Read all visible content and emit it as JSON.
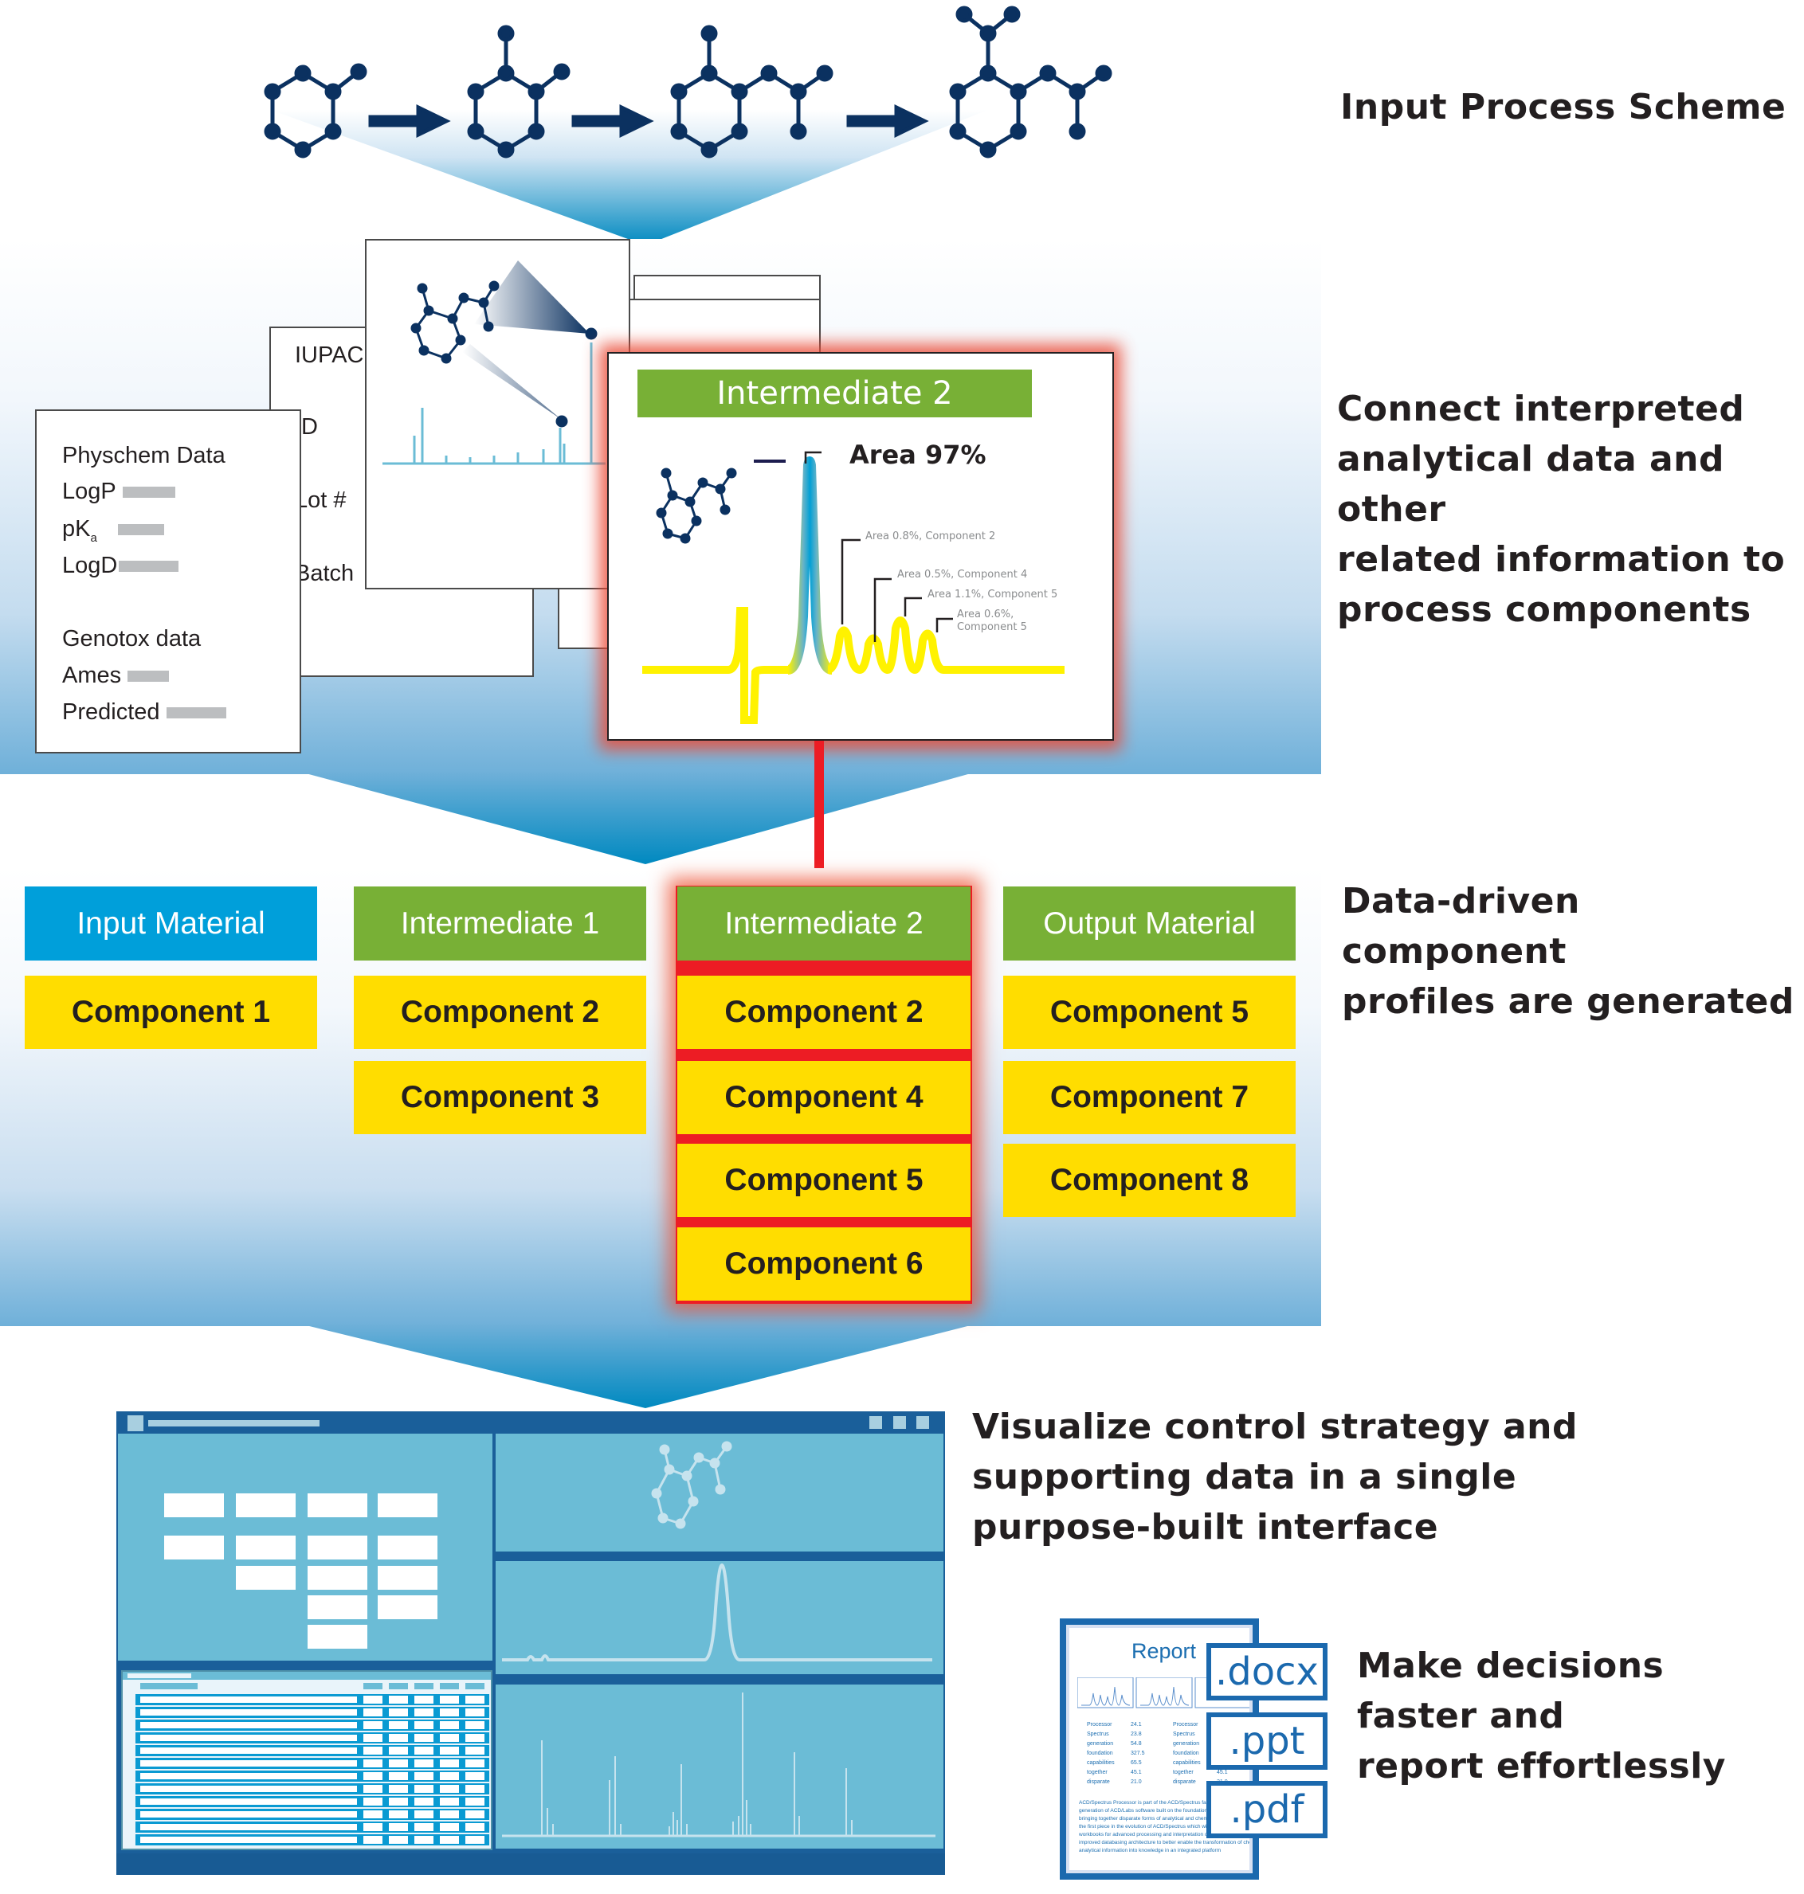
{
  "captions": {
    "step1": "Input Process Scheme",
    "step2": [
      "Connect interpreted",
      "analytical data and other",
      "related information to",
      "process components"
    ],
    "step3": [
      "Data-driven component",
      "profiles are generated"
    ],
    "step4": [
      "Visualize control strategy and",
      "supporting data in a single",
      "purpose-built interface"
    ],
    "step5": [
      "Make decisions",
      "faster and",
      "report effortlessly"
    ]
  },
  "process_scheme": {
    "molecules": [
      "starting-material",
      "intermediate-1",
      "intermediate-2",
      "output-material"
    ],
    "arrow_icon": "right-arrow-icon"
  },
  "physchem_doc": {
    "title": "Physchem Data",
    "fields": [
      {
        "label": "LogP"
      },
      {
        "label": "pK",
        "subscript": "a"
      },
      {
        "label": "LogD"
      }
    ],
    "genotox_title": "Genotox data",
    "genotox_fields": [
      {
        "label": "Ames"
      },
      {
        "label": "Predicted"
      }
    ]
  },
  "registry_doc": {
    "fields": [
      "IUPAC",
      "ID",
      "Lot #",
      "Batch"
    ]
  },
  "intermediate_doc": {
    "title": "Intermediate 2",
    "main_peak_label": "Area 97%",
    "peak_labels": [
      "Area 0.8%, Component 2",
      "Area 0.5%, Component 4",
      "Area 1.1%, Component 5",
      "Area 0.6%,",
      "Component 5"
    ]
  },
  "columns": [
    {
      "header": "Input Material",
      "type": "input",
      "components": [
        "Component 1"
      ]
    },
    {
      "header": "Intermediate 1",
      "type": "intermediate",
      "components": [
        "Component 2",
        "Component 3"
      ]
    },
    {
      "header": "Intermediate 2",
      "type": "intermediate",
      "highlighted": true,
      "components": [
        "Component 2",
        "Component 4",
        "Component 5",
        "Component 6"
      ]
    },
    {
      "header": "Output Material",
      "type": "intermediate",
      "components": [
        "Component 5",
        "Component 7",
        "Component 8"
      ]
    }
  ],
  "colors": {
    "input_header": "#009fda",
    "intermediate_header": "#78b036",
    "component": "#ffdd00",
    "highlight": "#ed1c24",
    "molecule": "#0b3160",
    "app_frame": "#1a5f9a",
    "app_panel": "#6bbcd6"
  },
  "report": {
    "title": "Report",
    "table_rows": [
      {
        "name": "Processor",
        "value": "24.1"
      },
      {
        "name": "Spectrus",
        "value": "23.8"
      },
      {
        "name": "generation",
        "value": "54.8"
      },
      {
        "name": "foundation",
        "value": "327.5"
      },
      {
        "name": "capabilities",
        "value": "65.5"
      },
      {
        "name": "together",
        "value": "45.1"
      },
      {
        "name": "disparate",
        "value": "21.0"
      }
    ],
    "paragraph": "ACD/Spectrus Processor is part of the ACD/Spectrus family of products–the next generation of ACD/Labs software built on the foundation of our unique capabilities in bringing together disparate forms of analytical and chemical information. Processor is the first piece in the evolution of ACD/Spectrus which will include analytical laboratory workbooks for advanced processing and interpretation of analytical data, and an improved databasing architecture to better enable the transformation of chemical and analytical information into knowledge in an integrated platform",
    "formats": [
      ".docx",
      ".ppt",
      ".pdf"
    ]
  }
}
